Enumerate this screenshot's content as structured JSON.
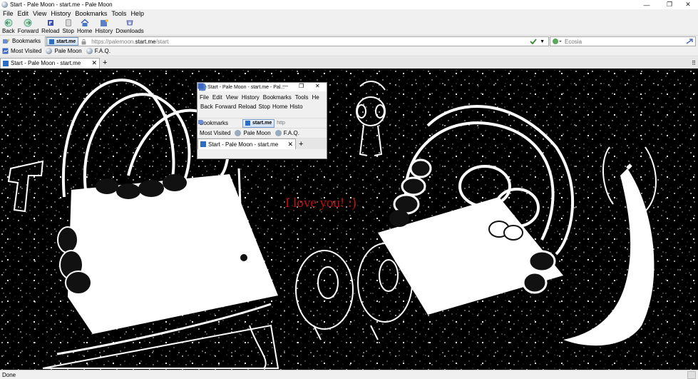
{
  "window": {
    "title": "Start - Pale Moon - start.me - Pale Moon",
    "minimize": "—",
    "restore": "❐",
    "close": "✕"
  },
  "menu": [
    "File",
    "Edit",
    "View",
    "History",
    "Bookmarks",
    "Tools",
    "Help"
  ],
  "nav": {
    "back": "Back",
    "forward": "Forward",
    "reload": "Reload",
    "stop": "Stop",
    "home": "Home",
    "history": "History",
    "downloads": "Downloads"
  },
  "urlbar": {
    "bookmarks_label": "Bookmarks",
    "identity": "start.me",
    "url_prefix": "https://palemoon.",
    "url_domain": "start.me",
    "url_suffix": "/start",
    "search_engine": "Ecosia"
  },
  "bookmarks_toolbar": [
    "Most Visited",
    "Pale Moon",
    "F.A.Q."
  ],
  "tab": {
    "title": "Start - Pale Moon - start.me",
    "close": "✕",
    "new": "+"
  },
  "page": {
    "message": "I love you! :)"
  },
  "inner_window": {
    "title": "Start - Pale Moon - start.me - Pal...",
    "menu": [
      "File",
      "Edit",
      "View",
      "History",
      "Bookmarks",
      "Tools",
      "He"
    ],
    "nav": [
      "Back",
      "Forward",
      "Reload",
      "Stop",
      "Home",
      "Histo"
    ],
    "bookmarks_label": "Bookmarks",
    "identity": "start.me",
    "url_fragment": "http",
    "bookmarks_toolbar": [
      "Most Visited",
      "Pale Moon",
      "F.A.Q."
    ],
    "tab_title": "Start - Pale Moon - start.me"
  },
  "status": {
    "text": "Done"
  },
  "colors": {
    "accent": "#2b6cc4",
    "message": "#c20d0d",
    "page_bg": "#000000"
  }
}
